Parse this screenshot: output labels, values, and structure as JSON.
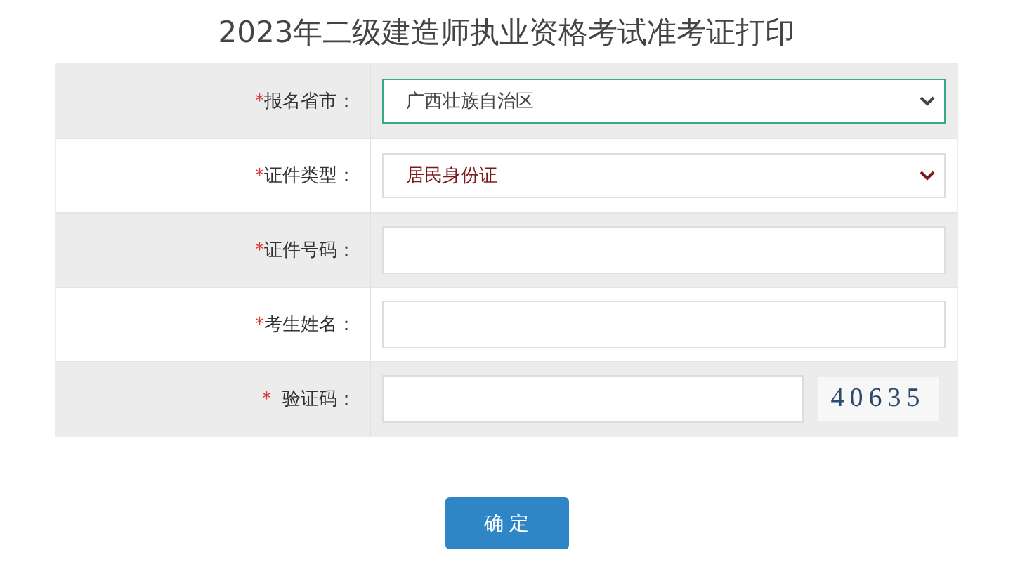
{
  "title": "2023年二级建造师执业资格考试准考证打印",
  "form": {
    "rows": [
      {
        "kind": "select",
        "marker": "*",
        "label": "报名省市：",
        "value": "广西壮族自治区",
        "focused": true
      },
      {
        "kind": "select",
        "marker": "*",
        "label": "证件类型：",
        "value": "居民身份证",
        "focused": false
      },
      {
        "kind": "text",
        "marker": "*",
        "label": "证件号码："
      },
      {
        "kind": "text",
        "marker": "*",
        "label": "考生姓名："
      },
      {
        "kind": "captcha",
        "marker": "*",
        "label": "验证码：",
        "captcha": "40635"
      }
    ]
  },
  "submit": "确 定"
}
